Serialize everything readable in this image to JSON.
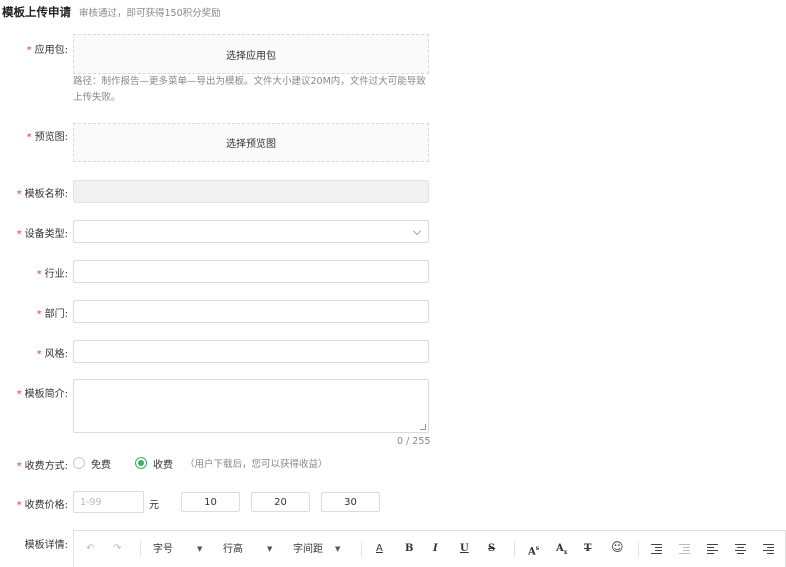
{
  "header": {
    "title": "模板上传申请",
    "subtitle": "审核通过，即可获得150积分奖励"
  },
  "form": {
    "app_package": {
      "label": "应用包:",
      "button": "选择应用包",
      "hint": "路径：制作报告—更多菜单—导出为模板。文件大小建议20M内，文件过大可能导致上传失败。"
    },
    "preview": {
      "label": "预览图:",
      "button": "选择预览图"
    },
    "template_name": {
      "label": "模板名称:"
    },
    "device_type": {
      "label": "设备类型:"
    },
    "industry": {
      "label": "行业:"
    },
    "department": {
      "label": "部门:"
    },
    "style": {
      "label": "风格:"
    },
    "intro": {
      "label": "模板简介:",
      "counter": "0 / 255"
    },
    "charge_mode": {
      "label": "收费方式:",
      "options": [
        "免费",
        "收费"
      ],
      "selected": "收费",
      "note": "（用户下载后，您可以获得收益）"
    },
    "price": {
      "label": "收费价格:",
      "placeholder": "1-99",
      "unit": "元",
      "presets": [
        "10",
        "20",
        "30"
      ]
    },
    "details": {
      "label": "模板详情:",
      "toolbar": {
        "undo": "↶",
        "redo": "↷",
        "font_size": "字号",
        "line_height": "行高",
        "letter_spacing": "字间距",
        "font_color": "A",
        "bold": "B",
        "italic": "I",
        "underline": "U",
        "strike": "S",
        "superscript": "A",
        "superscript_mark": "s",
        "subscript": "A",
        "subscript_mark": "x",
        "clear_format": "T",
        "emoji": "☺"
      }
    }
  },
  "colors": {
    "accent": "#3db05a",
    "required": "#e53935",
    "border": "#dcdcdc"
  }
}
